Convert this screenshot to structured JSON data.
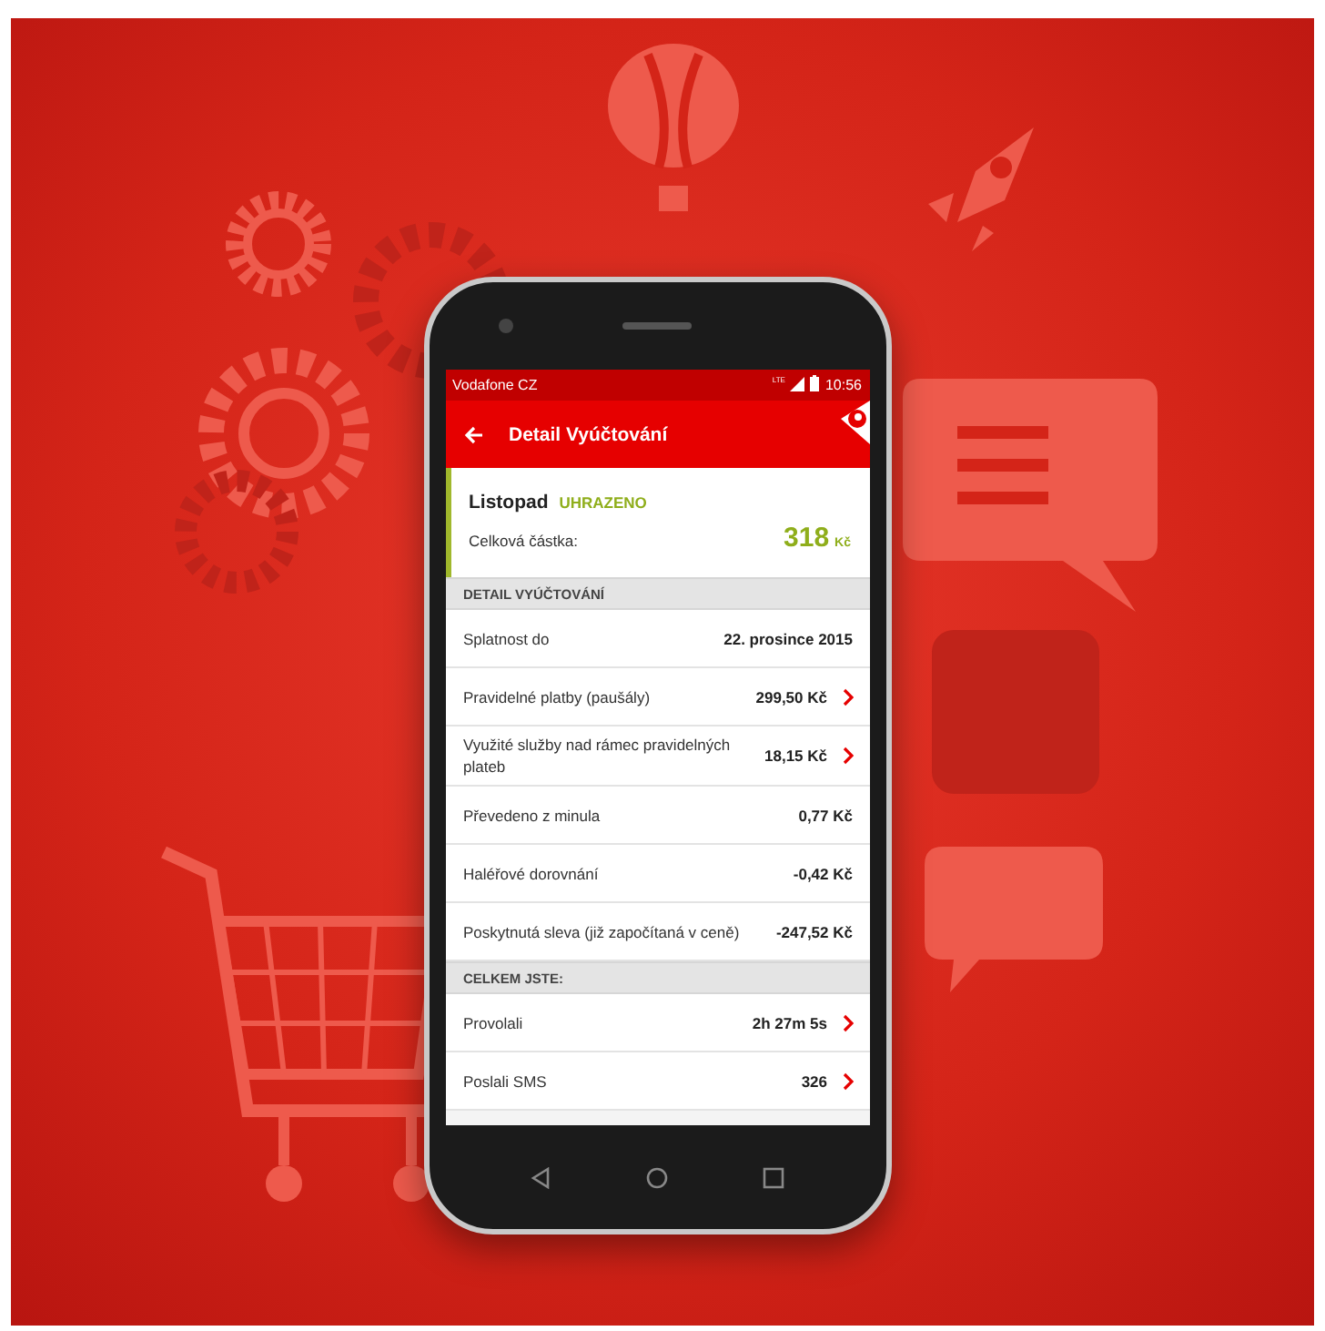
{
  "status_bar": {
    "carrier": "Vodafone CZ",
    "network": "LTE",
    "time": "10:56"
  },
  "app_bar": {
    "title": "Detail Vyúčtování"
  },
  "summary": {
    "month": "Listopad",
    "status": {
      "text": "UHRAZENO",
      "paid": true
    },
    "total_label": "Celková částka:",
    "amount": "318",
    "currency": "Kč"
  },
  "sections": [
    {
      "header": "DETAIL VYÚČTOVÁNÍ",
      "rows": [
        {
          "label": "Splatnost do",
          "value": "22. prosince 2015",
          "kind": "plain"
        },
        {
          "label": "Pravidelné platby (paušály)",
          "value": "299,50 Kč",
          "kind": "link"
        },
        {
          "label": "Využité služby nad rámec pravidelných plateb",
          "value": "18,15 Kč",
          "kind": "link"
        },
        {
          "label": "Převedeno z minula",
          "value": "0,77 Kč",
          "kind": "plain"
        },
        {
          "label": "Haléřové dorovnání",
          "value": "-0,42 Kč",
          "kind": "plain"
        },
        {
          "label": "Poskytnutá sleva (již započítaná v ceně)",
          "value": "-247,52 Kč",
          "kind": "plain"
        }
      ]
    },
    {
      "header": "CELKEM JSTE:",
      "rows": [
        {
          "label": "Provolali",
          "value": "2h 27m 5s",
          "kind": "link"
        },
        {
          "label": "Poslali SMS",
          "value": "326",
          "kind": "link"
        }
      ]
    }
  ]
}
